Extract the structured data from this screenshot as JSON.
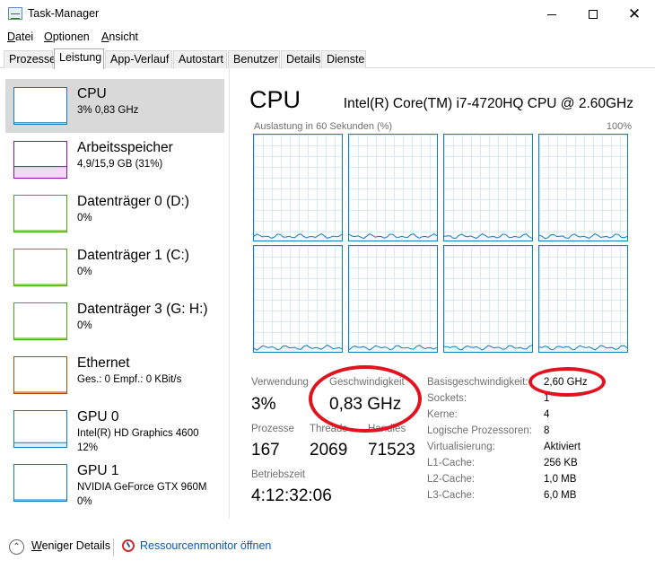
{
  "window": {
    "title": "Task-Manager"
  },
  "menu": [
    {
      "underlined": "D",
      "rest": "atei"
    },
    {
      "underlined": "O",
      "rest": "ptionen"
    },
    {
      "underlined": "A",
      "rest": "nsicht"
    }
  ],
  "tabs": [
    "Prozesse",
    "Leistung",
    "App-Verlauf",
    "Autostart",
    "Benutzer",
    "Details",
    "Dienste"
  ],
  "active_tab": "Leistung",
  "sidebar": [
    {
      "title": "CPU",
      "sub1": "3% 0,83 GHz",
      "sub2": "",
      "sub3": "",
      "color": "#117dbb",
      "level": 0.03
    },
    {
      "title": "Arbeitsspeicher",
      "sub1": "4,9/15,9 GB (31%)",
      "sub2": "",
      "sub3": "",
      "color": "#8b12ae",
      "level": 0.31
    },
    {
      "title": "Datenträger 0 (D:)",
      "sub1": "0%",
      "sub2": "",
      "sub3": "",
      "color": "#4da60c",
      "level": 0
    },
    {
      "title": "Datenträger 1 (C:)",
      "sub1": "0%",
      "sub2": "",
      "sub3": "",
      "color": "#4da60c",
      "level": 0
    },
    {
      "title": "Datenträger 3 (G: H:)",
      "sub1": "0%",
      "sub2": "",
      "sub3": "",
      "color": "#4da60c",
      "level": 0
    },
    {
      "title": "Ethernet",
      "sub1": "Ges.: 0 Empf.: 0 KBit/s",
      "sub2": "",
      "sub3": "",
      "color": "#a74f01",
      "level": 0
    },
    {
      "title": "GPU 0",
      "sub1": "Intel(R) HD Graphics 4600",
      "sub2": "12%",
      "sub3": "",
      "color": "#117dbb",
      "level": 0.12
    },
    {
      "title": "GPU 1",
      "sub1": "NVIDIA GeForce GTX 960M",
      "sub2": "0%",
      "sub3": "",
      "color": "#117dbb",
      "level": 0
    }
  ],
  "cpu": {
    "heading": "CPU",
    "model": "Intel(R) Core(TM) i7-4720HQ CPU @ 2.60GHz",
    "graph_label": "Auslastung in 60 Sekunden (%)",
    "graph_max": "100%",
    "core_count": 8,
    "stats": {
      "usage_label": "Verwendung",
      "usage_value": "3%",
      "speed_label": "Geschwindigkeit",
      "speed_value": "0,83 GHz",
      "processes_label": "Prozesse",
      "processes_value": "167",
      "threads_label": "Threads",
      "threads_value": "2069",
      "handles_label": "Handles",
      "handles_value": "71523",
      "uptime_label": "Betriebszeit",
      "uptime_value": "4:12:32:06"
    },
    "details": [
      {
        "label": "Basisgeschwindigkeit:",
        "value": "2,60 GHz"
      },
      {
        "label": "Sockets:",
        "value": "1"
      },
      {
        "label": "Kerne:",
        "value": "4"
      },
      {
        "label": "Logische Prozessoren:",
        "value": "8"
      },
      {
        "label": "Virtualisierung:",
        "value": "Aktiviert"
      },
      {
        "label": "L1-Cache:",
        "value": "256 KB"
      },
      {
        "label": "L2-Cache:",
        "value": "1,0 MB"
      },
      {
        "label": "L3-Cache:",
        "value": "6,0 MB"
      }
    ]
  },
  "footer": {
    "fewer_underlined": "W",
    "fewer_rest": "eniger Details",
    "resmon_link": "Ressourcenmonitor öffnen"
  }
}
